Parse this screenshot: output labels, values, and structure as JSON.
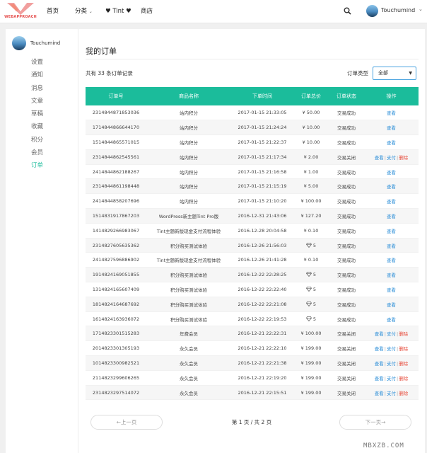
{
  "header": {
    "logo_text": "WEBAPPROACH",
    "nav": [
      {
        "label": "首页"
      },
      {
        "label": "分类"
      },
      {
        "label": "♥ Tint ♥"
      },
      {
        "label": "商店"
      }
    ],
    "search_icon": "search-icon",
    "user": {
      "name": "Touchumind"
    }
  },
  "sidebar": {
    "username": "Touchumind",
    "items": [
      {
        "label": "设置"
      },
      {
        "label": "通知"
      },
      {
        "label": "消息"
      },
      {
        "label": "文章"
      },
      {
        "label": "草稿"
      },
      {
        "label": "收藏"
      },
      {
        "label": "积分"
      },
      {
        "label": "会员"
      },
      {
        "label": "订单",
        "active": true
      }
    ]
  },
  "main": {
    "title": "我的订单",
    "record_count": "共有 33 条订单记录",
    "filter": {
      "label": "订单类型",
      "selected": "全部"
    },
    "columns": [
      "订单号",
      "商品名称",
      "下单时间",
      "订单总价",
      "订单状态",
      "操作"
    ],
    "orders": [
      {
        "id": "2314844871853036",
        "name": "站内积分",
        "time": "2017-01-15 21:33:05",
        "price": "¥ 50.00",
        "status": "交易成功",
        "actions": [
          "查看"
        ]
      },
      {
        "id": "1714844866644170",
        "name": "站内积分",
        "time": "2017-01-15 21:24:24",
        "price": "¥ 10.00",
        "status": "交易成功",
        "actions": [
          "查看"
        ]
      },
      {
        "id": "1514844865571015",
        "name": "站内积分",
        "time": "2017-01-15 21:22:37",
        "price": "¥ 10.00",
        "status": "交易成功",
        "actions": [
          "查看"
        ]
      },
      {
        "id": "2314844862545561",
        "name": "站内积分",
        "time": "2017-01-15 21:17:34",
        "price": "¥ 2.00",
        "status": "交易关闭",
        "actions": [
          "查看",
          "支付",
          "删除"
        ]
      },
      {
        "id": "2414844862188267",
        "name": "站内积分",
        "time": "2017-01-15 21:16:58",
        "price": "¥ 1.00",
        "status": "交易成功",
        "actions": [
          "查看"
        ]
      },
      {
        "id": "2314844861198448",
        "name": "站内积分",
        "time": "2017-01-15 21:15:19",
        "price": "¥ 5.00",
        "status": "交易成功",
        "actions": [
          "查看"
        ]
      },
      {
        "id": "2414844858207696",
        "name": "站内积分",
        "time": "2017-01-15 21:10:20",
        "price": "¥ 100.00",
        "status": "交易成功",
        "actions": [
          "查看"
        ]
      },
      {
        "id": "1514831917867203",
        "name": "WordPress新主题Tint Pro版",
        "time": "2016-12-31 21:43:06",
        "price": "¥ 127.20",
        "status": "交易成功",
        "actions": [
          "查看"
        ]
      },
      {
        "id": "1414829266983067",
        "name": "Tint主题新版现金支付流程体验",
        "time": "2016-12-28 20:04:58",
        "price": "¥ 0.10",
        "status": "交易成功",
        "actions": [
          "查看"
        ]
      },
      {
        "id": "2314827605635362",
        "name": "积分购买测试体验",
        "time": "2016-12-26 21:56:03",
        "price": "5",
        "diamond": true,
        "status": "交易成功",
        "actions": [
          "查看"
        ]
      },
      {
        "id": "2414827596886902",
        "name": "Tint主题新版现金支付流程体验",
        "time": "2016-12-26 21:41:28",
        "price": "¥ 0.10",
        "status": "交易成功",
        "actions": [
          "查看"
        ]
      },
      {
        "id": "1914824169051855",
        "name": "积分购买测试体验",
        "time": "2016-12-22 22:28:25",
        "price": "5",
        "diamond": true,
        "status": "交易成功",
        "actions": [
          "查看"
        ]
      },
      {
        "id": "1314824165607409",
        "name": "积分购买测试体验",
        "time": "2016-12-22 22:22:40",
        "price": "5",
        "diamond": true,
        "status": "交易成功",
        "actions": [
          "查看"
        ]
      },
      {
        "id": "1814824164687692",
        "name": "积分购买测试体验",
        "time": "2016-12-22 22:21:08",
        "price": "5",
        "diamond": true,
        "status": "交易成功",
        "actions": [
          "查看"
        ]
      },
      {
        "id": "1614824163936072",
        "name": "积分购买测试体验",
        "time": "2016-12-22 22:19:53",
        "price": "5",
        "diamond": true,
        "status": "交易成功",
        "actions": [
          "查看"
        ]
      },
      {
        "id": "1714823301515283",
        "name": "年费会员",
        "time": "2016-12-21 22:22:31",
        "price": "¥ 100.00",
        "status": "交易关闭",
        "actions": [
          "查看",
          "支付",
          "删除"
        ]
      },
      {
        "id": "2014823301305193",
        "name": "永久会员",
        "time": "2016-12-21 22:22:10",
        "price": "¥ 199.00",
        "status": "交易关闭",
        "actions": [
          "查看",
          "支付",
          "删除"
        ]
      },
      {
        "id": "1014823300982521",
        "name": "永久会员",
        "time": "2016-12-21 22:21:38",
        "price": "¥ 199.00",
        "status": "交易关闭",
        "actions": [
          "查看",
          "支付",
          "删除"
        ]
      },
      {
        "id": "2114823299606265",
        "name": "永久会员",
        "time": "2016-12-21 22:19:20",
        "price": "¥ 199.00",
        "status": "交易关闭",
        "actions": [
          "查看",
          "支付",
          "删除"
        ]
      },
      {
        "id": "2314823297514072",
        "name": "永久会员",
        "time": "2016-12-21 22:15:51",
        "price": "¥ 199.00",
        "status": "交易关闭",
        "actions": [
          "查看",
          "支付",
          "删除"
        ]
      }
    ],
    "pagination": {
      "prev": "←上一页",
      "info": "第 1 页 / 共 2 页",
      "next": "下一页→"
    }
  },
  "watermark": "MBXZB.COM",
  "colors": {
    "accent": "#1bbc9b",
    "link": "#2d8fd8",
    "delete": "#e74c3c",
    "logo": "#e5504f"
  }
}
